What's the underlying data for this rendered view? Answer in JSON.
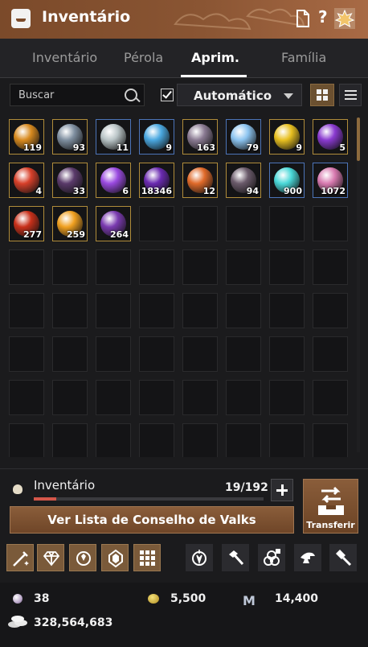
{
  "window": {
    "title": "Inventário",
    "header_buttons": [
      "document-icon",
      "help-icon",
      "settings-icon"
    ]
  },
  "tabs": [
    {
      "label": "Inventário",
      "active": false
    },
    {
      "label": "Pérola",
      "active": false
    },
    {
      "label": "Aprim.",
      "active": true
    },
    {
      "label": "Família",
      "active": false
    }
  ],
  "filters": {
    "search_placeholder": "Buscar",
    "auto_checked": true,
    "sort_mode": "Automático",
    "view_mode": "grid"
  },
  "items": [
    {
      "icon": "amber-stone",
      "color": "#d88a1f",
      "qty": "119"
    },
    {
      "icon": "black-stone",
      "color": "#7f8fa0",
      "qty": "93"
    },
    {
      "icon": "silver-orb",
      "color": "#b9c4c6",
      "qty": "11"
    },
    {
      "icon": "blue-crystal",
      "color": "#4aa8e0",
      "qty": "9"
    },
    {
      "icon": "dark-stone",
      "color": "#8a7a92",
      "qty": "163"
    },
    {
      "icon": "blue-stone",
      "color": "#8cc4f0",
      "qty": "79"
    },
    {
      "icon": "golden-stone",
      "color": "#e8c020",
      "qty": "9"
    },
    {
      "icon": "purple-stone",
      "color": "#8a3ad0",
      "qty": "5"
    },
    {
      "icon": "red-stone",
      "color": "#d8402a",
      "qty": "4"
    },
    {
      "icon": "dark-crystal",
      "color": "#5a3a6a",
      "qty": "33"
    },
    {
      "icon": "violet-shard",
      "color": "#9a4ae0",
      "qty": "6"
    },
    {
      "icon": "void-stone",
      "color": "#6a2ab0",
      "qty": "18346"
    },
    {
      "icon": "ember-stone",
      "color": "#e06a2a",
      "qty": "12"
    },
    {
      "icon": "obsidian-stone",
      "color": "#6a5a6a",
      "qty": "94"
    },
    {
      "icon": "cyan-orb",
      "color": "#4ad8d8",
      "qty": "900"
    },
    {
      "icon": "rose-stone",
      "color": "#d87ab0",
      "qty": "1072"
    },
    {
      "icon": "crimson-stone",
      "color": "#c8301a",
      "qty": "277"
    },
    {
      "icon": "flame-stone",
      "color": "#f0a020",
      "qty": "259"
    },
    {
      "icon": "amethyst-stone",
      "color": "#7a3ab0",
      "qty": "264"
    }
  ],
  "inventory": {
    "label": "Inventário",
    "count": "19/192",
    "fill": 0.099
  },
  "buttons": {
    "valks": "Ver Lista de Conselho de Valks",
    "transfer": "Transferir"
  },
  "toolbar": [
    "sparkle-sword-icon",
    "diamond-icon",
    "cycle-stone-icon",
    "crystal-box-icon",
    "grid-pattern-icon",
    "compass-icon",
    "hammer-icon",
    "swirl-icon",
    "anvil-icon",
    "smithing-hammer-icon"
  ],
  "currency": {
    "pearls": "38",
    "coins": "5,500",
    "mileage": "14,400",
    "silver": "328,564,683"
  }
}
